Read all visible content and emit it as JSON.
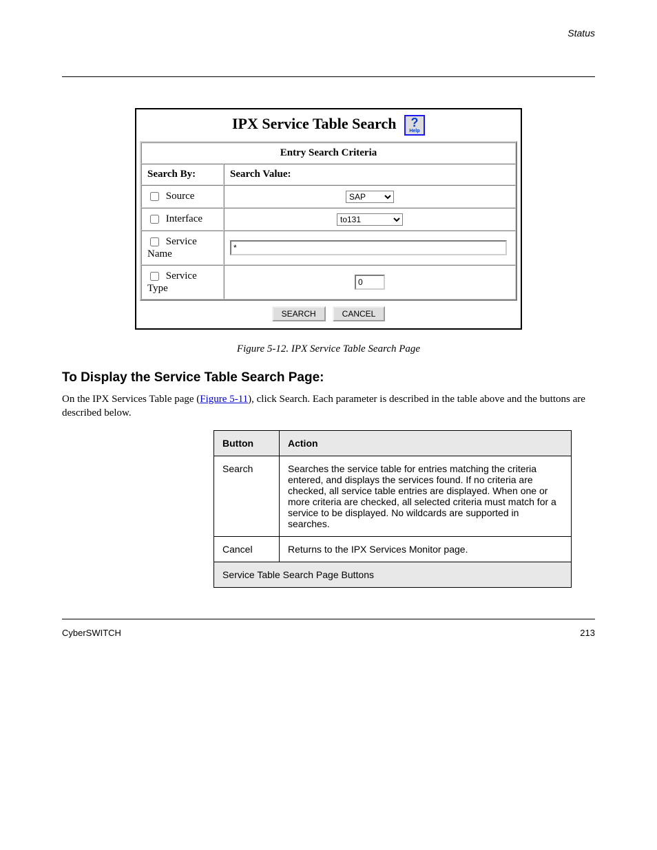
{
  "header_right": "Status",
  "figure": {
    "title": "IPX Service Table Search",
    "help_icon_label": "Help",
    "criteria_header": "Entry Search Criteria",
    "col_search_by": "Search By:",
    "col_search_value": "Search Value:",
    "rows": {
      "source_label": "Source",
      "source_value": "SAP",
      "interface_label": "Interface",
      "interface_value": "to131",
      "service_name_label": "Service Name",
      "service_name_value": "*",
      "service_type_label": "Service Type",
      "service_type_value": "0"
    },
    "buttons": {
      "search": "SEARCH",
      "cancel": "CANCEL"
    }
  },
  "caption": "Figure 5-12. IPX Service Table Search Page",
  "section": {
    "title": "To Display the Service Table Search Page:",
    "para1_pre": "On the IPX Services Table page (",
    "para1_link": "Figure 5-11",
    "para1_post": "), click Search. Each parameter is described in the table above and the buttons are described below.",
    "tbl": {
      "h1": "Button",
      "h2": "Action",
      "r1c1": "Search",
      "r1c2": "Searches the service table for entries matching the criteria entered, and displays the services found. If no criteria are checked, all service table entries are displayed. When one or more criteria are checked, all selected criteria must match for a service to be displayed. No wildcards are supported in searches.",
      "r2c1": "Cancel",
      "r2c2": "Returns to the IPX Services Monitor page.",
      "footer": "Service Table Search Page Buttons"
    }
  },
  "footer": {
    "left": "CyberSWITCH",
    "right": "213"
  }
}
